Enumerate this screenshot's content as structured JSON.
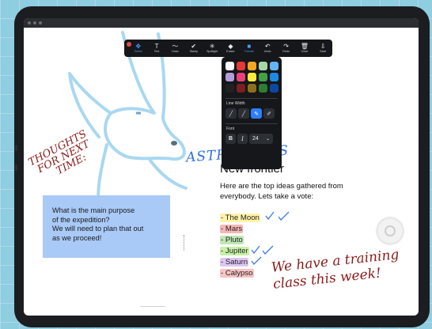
{
  "toolbar": {
    "tools": [
      {
        "label": "Select",
        "icon": "select-icon",
        "glyph": "✥",
        "active": true
      },
      {
        "label": "Text",
        "icon": "text-icon",
        "glyph": "T",
        "active": false
      },
      {
        "label": "Draw",
        "icon": "draw-icon",
        "glyph": "〜",
        "active": false
      },
      {
        "label": "Stamp",
        "icon": "stamp-icon",
        "glyph": "✔",
        "active": false
      },
      {
        "label": "Spotlight",
        "icon": "spotlight-icon",
        "glyph": "✳",
        "active": false
      },
      {
        "label": "Eraser",
        "icon": "eraser-icon",
        "glyph": "◆",
        "active": false
      },
      {
        "label": "Format",
        "icon": "format-icon",
        "glyph": "■",
        "active": true
      },
      {
        "label": "Undo",
        "icon": "undo-icon",
        "glyph": "↶",
        "active": false
      },
      {
        "label": "Redo",
        "icon": "redo-icon",
        "glyph": "↷",
        "active": false
      },
      {
        "label": "Clear",
        "icon": "clear-icon",
        "glyph": "🗑",
        "active": false
      },
      {
        "label": "Save",
        "icon": "save-icon",
        "glyph": "⇩",
        "active": false
      }
    ]
  },
  "format_panel": {
    "colors": [
      "#ffffff",
      "#e53935",
      "#f5a623",
      "#a5d6a7",
      "#64b5f6",
      "#b39ddb",
      "#ec407a",
      "#ffeb3b",
      "#43a047",
      "#1e88e5",
      "#212121",
      "#7b1f1f",
      "#8d6e1a",
      "#2e7d32",
      "#0d47a1"
    ],
    "line_width_label": "Line Width",
    "font_label": "Font",
    "bold": "B",
    "italic": "I",
    "font_size": "24",
    "font_size_caret": "⌄"
  },
  "whiteboard": {
    "handwriting_left": [
      "THOUGHTS",
      "FOR NEXT",
      "TIME:"
    ],
    "handwriting_title": "ASTRO DOGS",
    "handwriting_bottom": [
      "We have a training",
      "class this week!"
    ],
    "note_lines": [
      "What is the main purpose",
      "of the expedition?",
      "We will need to plan that out",
      "as we proceed!"
    ],
    "title": "New frontier",
    "intro": "Here are the top ideas gathered from everybody. Lets take a vote:",
    "planets": [
      {
        "text": "- The Moon",
        "highlight": "#fff3a8",
        "votes": 2
      },
      {
        "text": "- Mars",
        "highlight": "#f7b7b7",
        "votes": 0
      },
      {
        "text": "- Pluto",
        "highlight": "#bfe7b5",
        "votes": 0
      },
      {
        "text": "- Jupiter",
        "highlight": "#c8f0a8",
        "votes": 2
      },
      {
        "text": "- Saturn",
        "highlight": "#dcc6f2",
        "votes": 1
      },
      {
        "text": "- Calypso",
        "highlight": "#f7c3c3",
        "votes": 0
      }
    ]
  },
  "colors": {
    "ink_red": "#8b1a1a",
    "ink_blue": "#2f6fe0",
    "sketch": "#a9d8f0",
    "note": "#a9c9f7"
  }
}
